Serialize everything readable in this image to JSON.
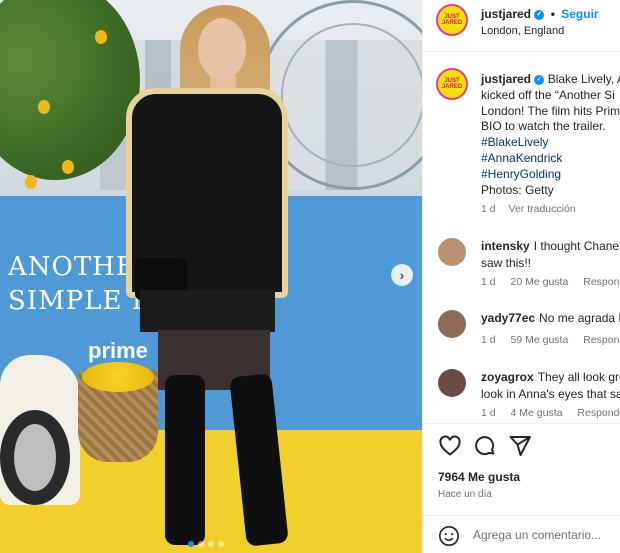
{
  "post": {
    "author": "justjared",
    "follow_label": "Seguir",
    "separator": "•",
    "location": "London, England",
    "avatar_text": "JUST JARED",
    "caption_lines": [
      "Blake Lively, A",
      "kicked off the “Another Si",
      "London! The film hits Prim",
      "BIO to watch the trailer."
    ],
    "hashtags": [
      "#BlakeLively",
      "#AnnaKendrick",
      "#HenryGolding"
    ],
    "credit": "Photos: Getty",
    "caption_age": "1 d",
    "see_translation": "Ver traducción"
  },
  "image": {
    "title_line1": "ANOTHE",
    "title_line2": "SIMPLE FA",
    "prime": "prime",
    "carousel_next": "›",
    "dot_count": 4
  },
  "comments": [
    {
      "user": "intensky",
      "text1": "I thought Chanel",
      "text2": "saw this!!",
      "age": "1 d",
      "likes": "20 Me gusta",
      "reply": "Responde",
      "avatar_color": "#b9906e"
    },
    {
      "user": "yady77ec",
      "text1": "No me agrada E",
      "text2": "",
      "age": "1 d",
      "likes": "59 Me gusta",
      "reply": "Responde",
      "avatar_color": "#8c6a55"
    },
    {
      "user": "zoyagrox",
      "text1": "They all look gre",
      "text2": "look in Anna's eyes that sa",
      "age": "1 d",
      "likes": "4 Me gusta",
      "reply": "Responder",
      "avatar_color": "#6b4b44"
    }
  ],
  "stats": {
    "likes": "7964 Me gusta",
    "posted": "Hace un día"
  },
  "comment_box": {
    "placeholder": "Agrega un comentario..."
  },
  "icons": [
    "heart-icon",
    "comment-icon",
    "share-icon",
    "emoji-icon",
    "verified-icon",
    "chevron-right-icon"
  ],
  "colors": {
    "accent": "#0095f6",
    "hashtag": "#00376b",
    "muted": "#737373",
    "avatar_bg": "#f5e100",
    "avatar_ring": "#e23ea0"
  }
}
